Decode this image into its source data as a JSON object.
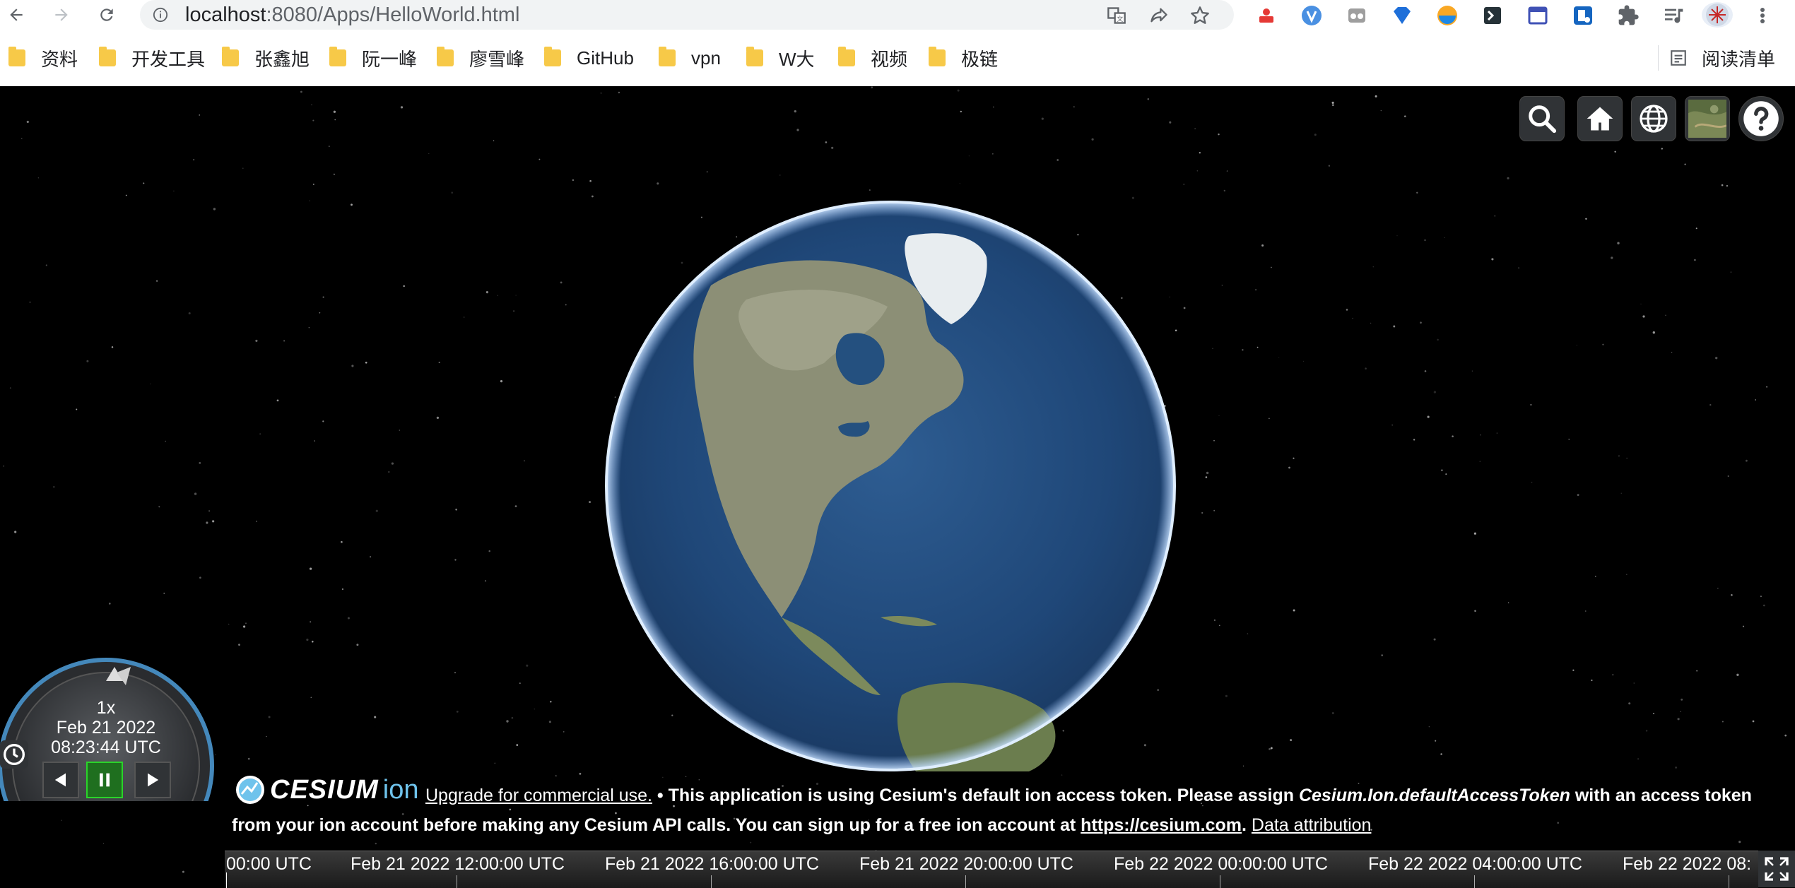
{
  "browser": {
    "url_host": "localhost",
    "url_rest": ":8080/Apps/HelloWorld.html",
    "bookmarks": [
      {
        "label": "资料"
      },
      {
        "label": "开发工具"
      },
      {
        "label": "张鑫旭"
      },
      {
        "label": "阮一峰"
      },
      {
        "label": "廖雪峰"
      },
      {
        "label": "GitHub"
      },
      {
        "label": "vpn"
      },
      {
        "label": "W大"
      },
      {
        "label": "视频"
      },
      {
        "label": "极链"
      }
    ],
    "reading_list": "阅读清单"
  },
  "viewer": {
    "animation": {
      "speed": "1x",
      "date": "Feb 21 2022",
      "time": "08:23:44 UTC"
    },
    "credits": {
      "logo_text": "CESIUM",
      "logo_ion": "ion",
      "upgrade": "Upgrade for commercial use.",
      "bullet": " • ",
      "msg1": "This application is using Cesium's default ion access token. Please assign ",
      "token_name": "Cesium.Ion.defaultAccessToken",
      "msg2": " with an access token",
      "msg3": "from your ion account before making any Cesium API calls. You can sign up for a free ion account at ",
      "site": "https://cesium.com",
      "period": ". ",
      "attribution": "Data attribution"
    },
    "timeline": {
      "labels": [
        "00:00 UTC",
        "Feb 21 2022 12:00:00 UTC",
        "Feb 21 2022 16:00:00 UTC",
        "Feb 21 2022 20:00:00 UTC",
        "Feb 22 2022 00:00:00 UTC",
        "Feb 22 2022 04:00:00 UTC",
        "Feb 22 2022 08:"
      ]
    }
  },
  "colors": {
    "background": "#000000",
    "button_bg": "#303336",
    "pause_active": "#2ad42a",
    "ion_blue": "#6fc3ec"
  },
  "icons": {
    "search": "search-icon",
    "home": "home-icon",
    "scene_mode": "globe-icon",
    "imagery": "imagery-thumbnail-icon",
    "help": "question-icon"
  }
}
